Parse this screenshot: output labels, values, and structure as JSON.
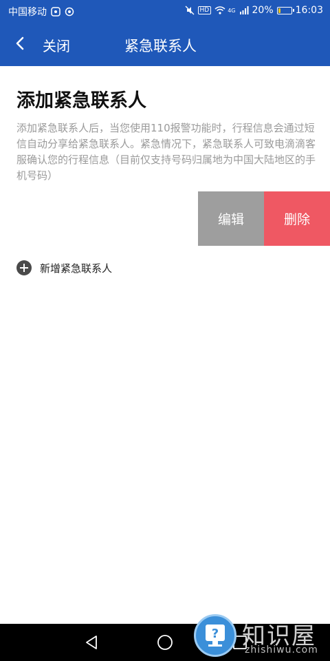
{
  "status_bar": {
    "carrier": "中国移动",
    "battery": "20%",
    "battery_level": 0.2,
    "time": "16:03",
    "hd_badge": "HD",
    "network": "4G",
    "icons": [
      "app-icon",
      "app-icon-2",
      "mute-icon",
      "wifi-icon",
      "signal-icon",
      "battery-icon"
    ]
  },
  "header": {
    "back_label": "关闭",
    "title": "紧急联系人"
  },
  "main": {
    "title": "添加紧急联系人",
    "description": "添加紧急联系人后，当您使用110报警功能时，行程信息会通过短信自动分享给紧急联系人。紧急情况下，紧急联系人可致电滴滴客服确认您的行程信息（目前仅支持号码归属地为中国大陆地区的手机号码）",
    "contact_actions": {
      "edit_label": "编辑",
      "delete_label": "删除"
    },
    "add_label": "新增紧急联系人"
  },
  "colors": {
    "accent": "#1f58b9",
    "edit_bg": "#9e9e9e",
    "delete_bg": "#ef5863"
  },
  "system_nav": {
    "icons": [
      "back-triangle-icon",
      "home-circle-icon",
      "recents-square-icon"
    ]
  },
  "watermark": {
    "text": "知识屋",
    "sub": "zhishiwu.com"
  }
}
